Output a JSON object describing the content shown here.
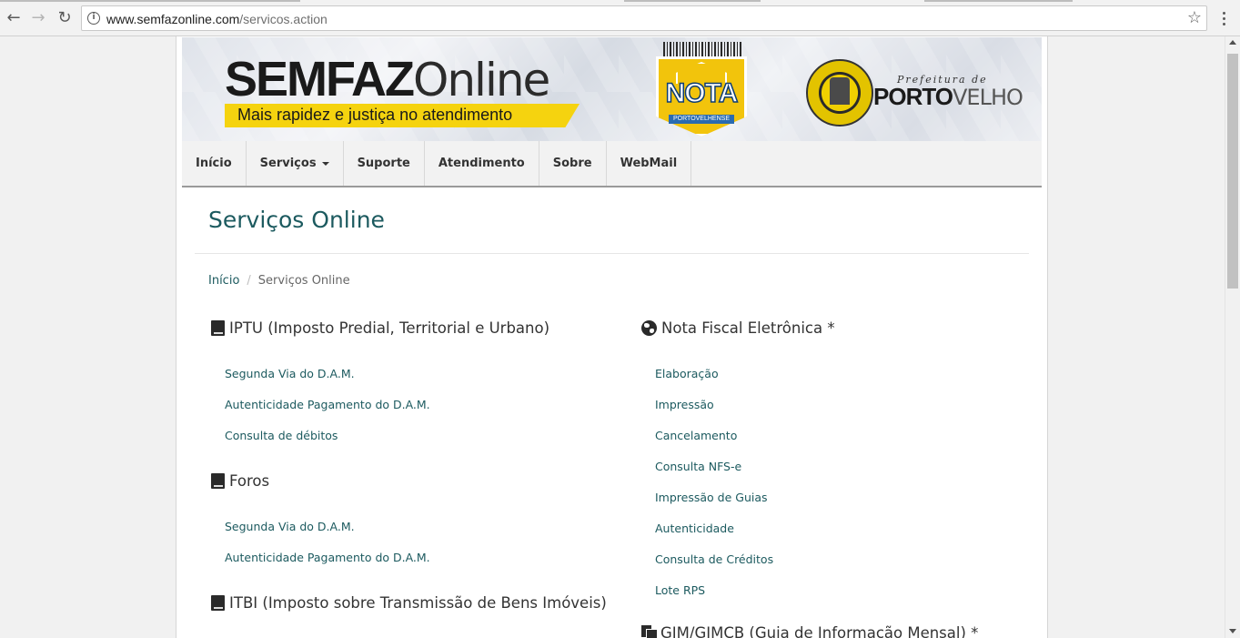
{
  "browser": {
    "url_host": "www.semfazonline.com",
    "url_path": "/servicos.action",
    "back_icon": "back-arrow-icon",
    "forward_icon": "forward-arrow-icon",
    "reload_icon": "reload-icon",
    "info_icon": "info-icon",
    "bookmark_icon": "star-icon",
    "menu_icon": "kebab-menu-icon"
  },
  "banner": {
    "logo_bold": "SEMFAZ",
    "logo_light": "Online",
    "tagline": "Mais rapidez e justiça no atendimento",
    "nota_title": "NOTA",
    "nota_sub": "PORTOVELHENSE",
    "prefeitura_small": "Prefeitura de",
    "prefeitura_bold": "PORTO",
    "prefeitura_light": "VELHO"
  },
  "navbar": {
    "items": [
      {
        "label": "Início"
      },
      {
        "label": "Serviços"
      },
      {
        "label": "Suporte"
      },
      {
        "label": "Atendimento"
      },
      {
        "label": "Sobre"
      },
      {
        "label": "WebMail"
      }
    ]
  },
  "page": {
    "title": "Serviços Online",
    "breadcrumb": {
      "home": "Início",
      "separator": "/",
      "current": "Serviços Online"
    }
  },
  "sections": {
    "iptu": {
      "title": "IPTU (Imposto Predial, Territorial e Urbano)",
      "icon": "book-icon",
      "links": [
        "Segunda Via do D.A.M.",
        "Autenticidade Pagamento do D.A.M.",
        "Consulta de débitos"
      ]
    },
    "foros": {
      "title": "Foros",
      "icon": "book-icon",
      "links": [
        "Segunda Via do D.A.M.",
        "Autenticidade Pagamento do D.A.M."
      ]
    },
    "itbi": {
      "title": "ITBI (Imposto sobre Transmissão de Bens Imóveis)",
      "icon": "book-icon"
    },
    "nfe": {
      "title": "Nota Fiscal Eletrônica *",
      "icon": "globe-icon",
      "links": [
        "Elaboração",
        "Impressão",
        "Cancelamento",
        "Consulta NFS-e",
        "Impressão de Guias",
        "Autenticidade",
        "Consulta de Créditos",
        "Lote RPS"
      ]
    },
    "gim": {
      "title": "GIM/GIMCB (Guia de Informação Mensal) *",
      "icon": "files-icon"
    }
  }
}
